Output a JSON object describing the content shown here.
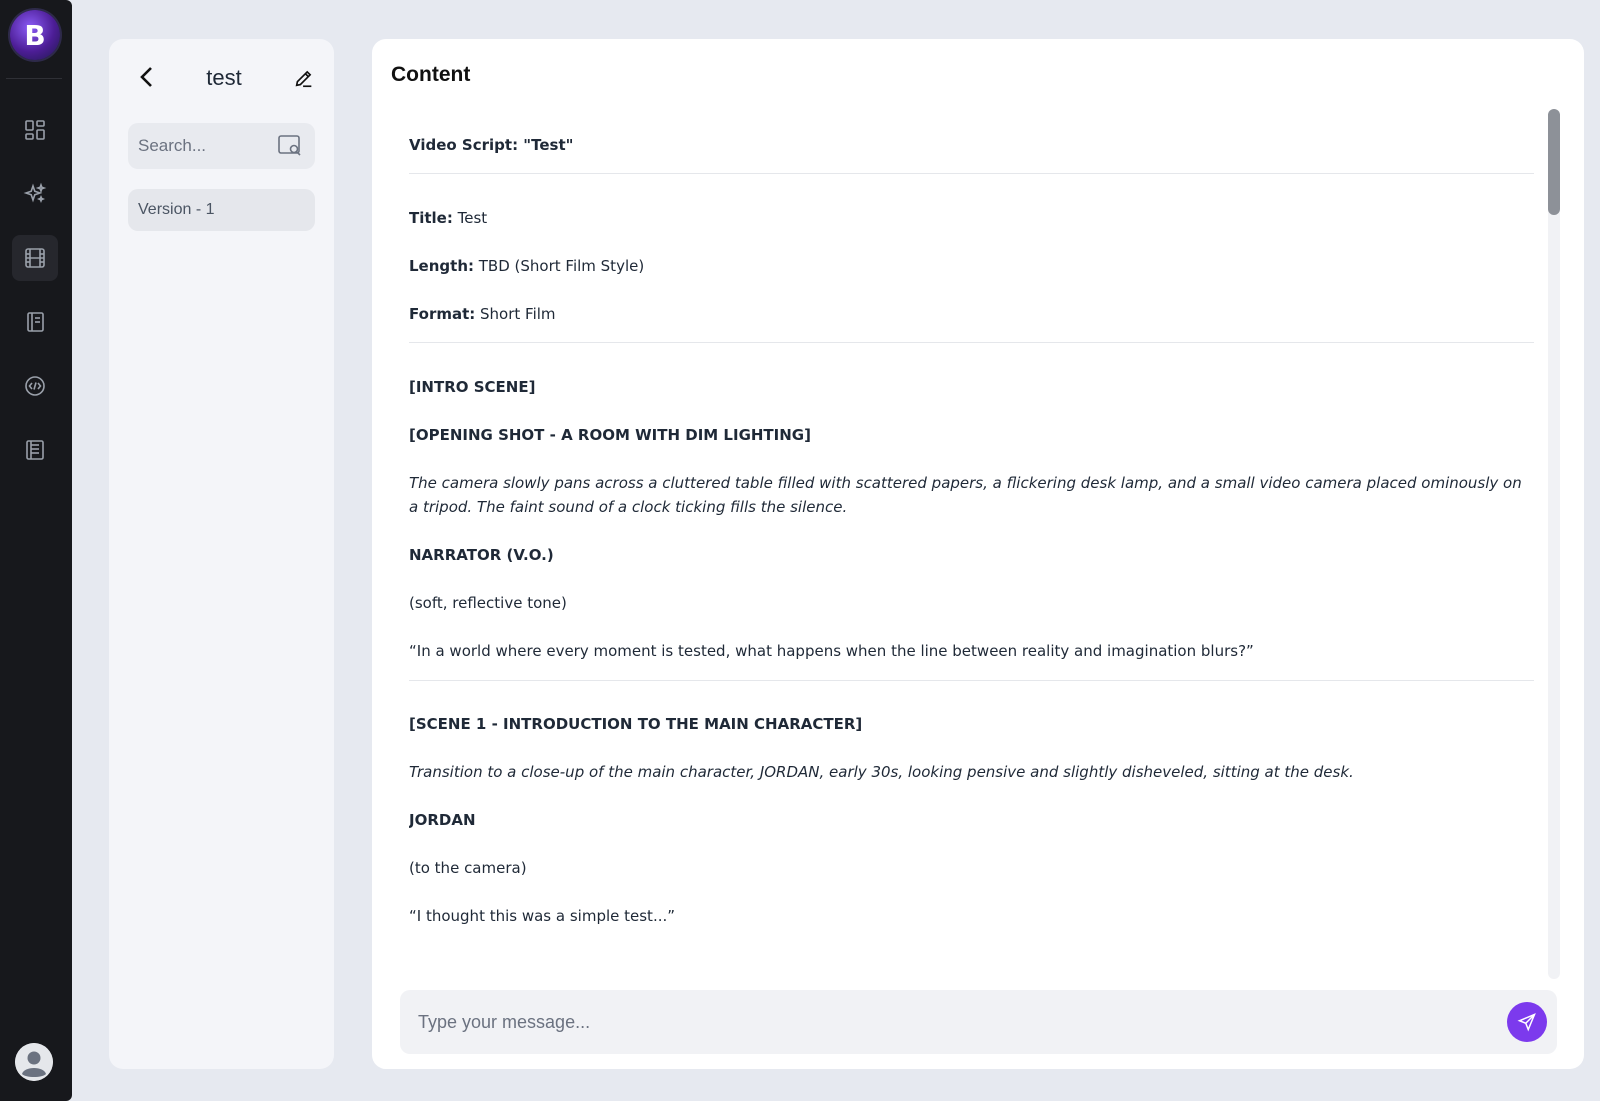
{
  "app": {
    "logo_letter": "B",
    "accent_color": "#7c3aed"
  },
  "rail": {
    "items": [
      {
        "icon": "dashboard-icon"
      },
      {
        "icon": "sparkles-icon"
      },
      {
        "icon": "film-icon",
        "active": true
      },
      {
        "icon": "notebook-icon"
      },
      {
        "icon": "code-circle-icon"
      },
      {
        "icon": "document-list-icon"
      }
    ],
    "profile_icon": "user-avatar-icon"
  },
  "sidebar": {
    "title": "test",
    "search_placeholder": "Search...",
    "versions": [
      "Version - 1"
    ]
  },
  "content": {
    "heading": "Content",
    "script": {
      "doc_title": "Video Script: \"Test\"",
      "title_label": "Title:",
      "title_value": " Test",
      "length_label": "Length:",
      "length_value": " TBD (Short Film Style)",
      "format_label": "Format:",
      "format_value": " Short Film",
      "intro_scene": "[INTRO SCENE]",
      "opening_shot": "[OPENING SHOT - A ROOM WITH DIM LIGHTING]",
      "opening_desc": "The camera slowly pans across a cluttered table filled with scattered papers, a flickering desk lamp, and a small video camera placed ominously on a tripod. The faint sound of a clock ticking fills the silence.",
      "narrator": "NARRATOR (V.O.)",
      "narrator_direction": "(soft, reflective tone)",
      "narrator_line": "“In a world where every moment is tested, what happens when the line between reality and imagination blurs?”",
      "scene1": "[SCENE 1 - INTRODUCTION TO THE MAIN CHARACTER]",
      "scene1_desc": "Transition to a close-up of the main character, JORDAN, early 30s, looking pensive and slightly disheveled, sitting at the desk.",
      "jordan": "JORDAN",
      "jordan_direction": "(to the camera)",
      "jordan_line": "“I thought this was a simple test...”"
    }
  },
  "composer": {
    "placeholder": "Type your message..."
  }
}
